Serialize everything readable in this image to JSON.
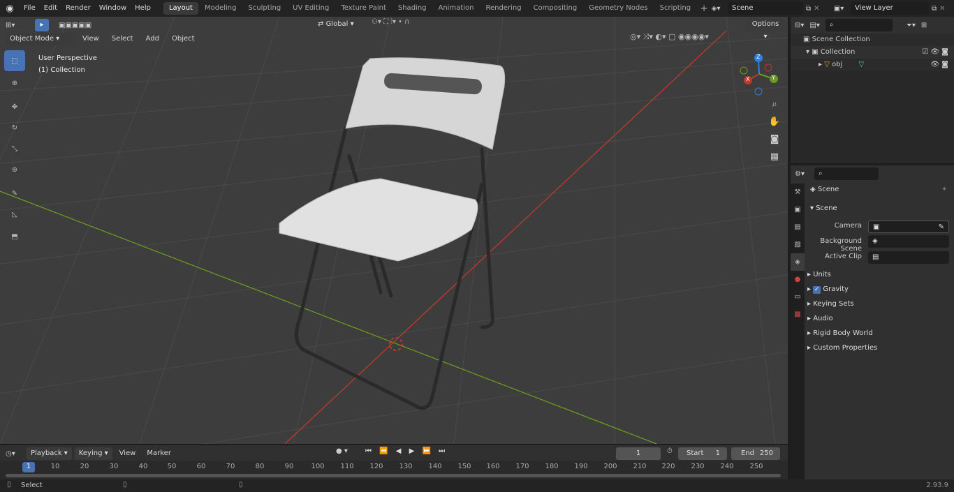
{
  "menus": [
    "File",
    "Edit",
    "Render",
    "Window",
    "Help"
  ],
  "workspaces": [
    "Layout",
    "Modeling",
    "Sculpting",
    "UV Editing",
    "Texture Paint",
    "Shading",
    "Animation",
    "Rendering",
    "Compositing",
    "Geometry Nodes",
    "Scripting"
  ],
  "active_workspace": "Layout",
  "scene_name": "Scene",
  "view_layer": "View Layer",
  "viewport": {
    "mode": "Object Mode",
    "menus": [
      "View",
      "Select",
      "Add",
      "Object"
    ],
    "transform": "Global",
    "options": "Options",
    "overlay_title": "User Perspective",
    "overlay_collection": "(1) Collection",
    "gizmo": {
      "x": "X",
      "y": "Y",
      "z": "Z"
    }
  },
  "outliner": {
    "scene_collection": "Scene Collection",
    "collection": "Collection",
    "object": "obj"
  },
  "properties": {
    "context": "Scene",
    "panel": "Scene",
    "fields": [
      {
        "label": "Camera"
      },
      {
        "label": "Background Scene"
      },
      {
        "label": "Active Clip"
      }
    ],
    "subpanels": [
      "Units",
      "Gravity",
      "Keying Sets",
      "Audio",
      "Rigid Body World",
      "Custom Properties"
    ]
  },
  "timeline": {
    "menus": [
      "Playback",
      "Keying",
      "View",
      "Marker"
    ],
    "current_frame": "1",
    "start_label": "Start",
    "start": "1",
    "end_label": "End",
    "end": "250",
    "ticks": [
      "1",
      "10",
      "20",
      "30",
      "40",
      "50",
      "60",
      "70",
      "80",
      "90",
      "100",
      "110",
      "120",
      "130",
      "140",
      "150",
      "160",
      "170",
      "180",
      "190",
      "200",
      "210",
      "220",
      "230",
      "240",
      "250"
    ]
  },
  "status": {
    "select": "Select",
    "version": "2.93.9"
  },
  "colors": {
    "accent": "#4772b3",
    "x_axis": "#c0392b",
    "y_axis": "#6a9a1f",
    "z_axis": "#2f7ee6",
    "chair": "#d8d8d8",
    "frame": "#2a2a2a"
  }
}
